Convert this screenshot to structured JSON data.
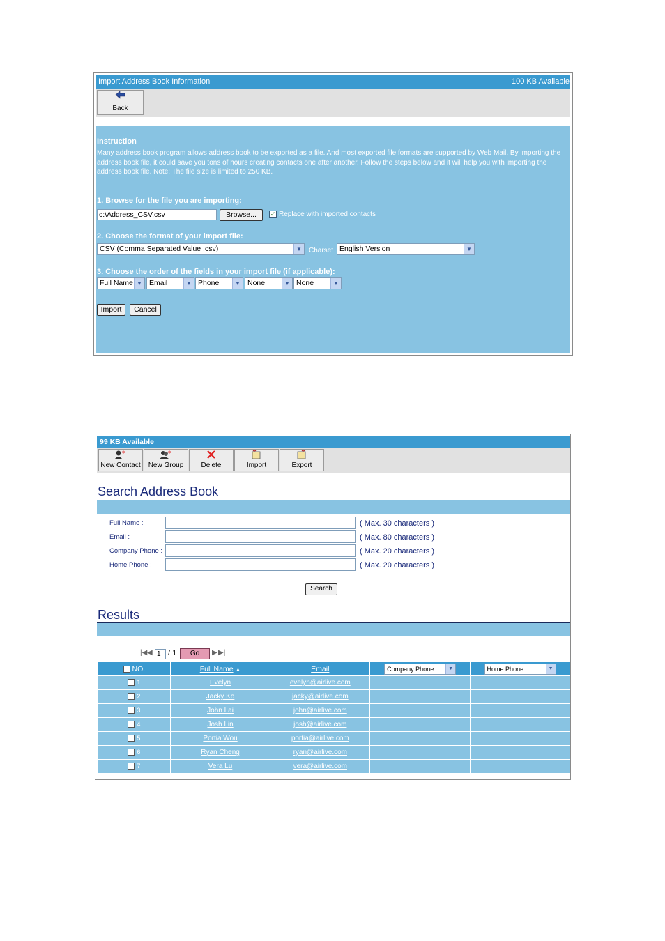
{
  "import_panel": {
    "title": "Import Address Book Information",
    "quota": "100 KB Available",
    "toolbar": {
      "back_label": "Back",
      "back_icon": "back-arrow-icon"
    },
    "instruction_heading": "Instruction",
    "instruction_text": "Many address book program allows address book to be exported as a file. And most exported file formats are supported by Web Mail. By importing the address book file, it could save you tons of hours creating contacts one after another. Follow the steps below and it will help you with importing the address book file. Note: The file size is limited to 250 KB.",
    "step1_label": "1. Browse for the file you are importing:",
    "file_path": "c:\\Address_CSV.csv",
    "browse_label": "Browse...",
    "replace_label": "Replace with imported contacts",
    "replace_checked": true,
    "step2_label": "2. Choose the format of your import file:",
    "format_value": "CSV (Comma Separated Value .csv)",
    "charset_label": "Charset",
    "charset_value": "English Version",
    "step3_label": "3. Choose the order of the fields in your import file (if applicable):",
    "field_order": [
      "Full Name",
      "Email",
      "Phone",
      "None",
      "None"
    ],
    "import_label": "Import",
    "cancel_label": "Cancel"
  },
  "address_panel": {
    "quota": "99 KB Available",
    "toolbar": [
      {
        "label": "New Contact",
        "icon": "new-contact-icon"
      },
      {
        "label": "New Group",
        "icon": "new-group-icon"
      },
      {
        "label": "Delete",
        "icon": "delete-x-icon"
      },
      {
        "label": "Import",
        "icon": "import-book-icon"
      },
      {
        "label": "Export",
        "icon": "export-book-icon"
      }
    ],
    "search_title": "Search Address Book",
    "fields": [
      {
        "label": "Full Name :",
        "hint": "( Max. 30 characters )"
      },
      {
        "label": "Email :",
        "hint": "( Max. 80 characters )"
      },
      {
        "label": "Company Phone :",
        "hint": "( Max. 20 characters )"
      },
      {
        "label": "Home Phone :",
        "hint": "( Max. 20 characters )"
      }
    ],
    "search_label": "Search",
    "results_title": "Results",
    "pagination": {
      "current": "1",
      "total_text": "/ 1",
      "go_label": "Go"
    },
    "columns": {
      "no": "NO.",
      "name": "Full Name",
      "email": "Email",
      "col4": "Company Phone",
      "col5": "Home Phone"
    },
    "rows": [
      {
        "no": "1",
        "name": "Evelyn",
        "email": "evelyn@airlive.com"
      },
      {
        "no": "2",
        "name": "Jacky Ko",
        "email": "jacky@airlive.com"
      },
      {
        "no": "3",
        "name": "John Lai",
        "email": "john@airlive.com"
      },
      {
        "no": "4",
        "name": "Josh Lin",
        "email": "josh@airlive.com"
      },
      {
        "no": "5",
        "name": "Portia Wou",
        "email": "portia@airlive.com"
      },
      {
        "no": "6",
        "name": "Ryan Cheng",
        "email": "ryan@airlive.com"
      },
      {
        "no": "7",
        "name": "Vera Lu",
        "email": "vera@airlive.com"
      }
    ]
  },
  "colors": {
    "header_blue": "#3a9ad0",
    "panel_blue": "#88c3e2",
    "toolbar_gray": "#e1e1e1",
    "title_navy": "#1a2a7a"
  }
}
